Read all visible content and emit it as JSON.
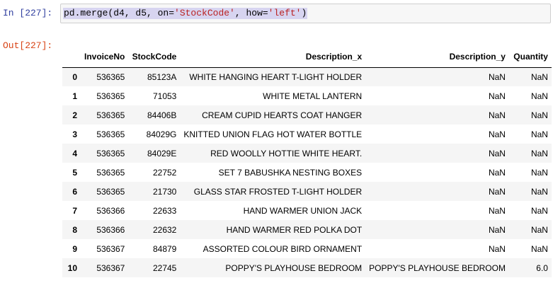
{
  "cell": {
    "in_prompt": "In [227]:",
    "out_prompt": "Out[227]:",
    "code_prefix": "pd.merge(d4, d5, on=",
    "code_arg1": "'StockCode'",
    "code_mid": ", how=",
    "code_arg2": "'left'",
    "code_suffix": ")"
  },
  "table": {
    "columns": [
      "",
      "InvoiceNo",
      "StockCode",
      "Description_x",
      "Description_y",
      "Quantity"
    ],
    "rows": [
      {
        "index": "0",
        "invoice": "536365",
        "stock": "85123A",
        "desc_x": "WHITE HANGING HEART T-LIGHT HOLDER",
        "desc_y": "NaN",
        "qty": "NaN"
      },
      {
        "index": "1",
        "invoice": "536365",
        "stock": "71053",
        "desc_x": "WHITE METAL LANTERN",
        "desc_y": "NaN",
        "qty": "NaN"
      },
      {
        "index": "2",
        "invoice": "536365",
        "stock": "84406B",
        "desc_x": "CREAM CUPID HEARTS COAT HANGER",
        "desc_y": "NaN",
        "qty": "NaN"
      },
      {
        "index": "3",
        "invoice": "536365",
        "stock": "84029G",
        "desc_x": "KNITTED UNION FLAG HOT WATER BOTTLE",
        "desc_y": "NaN",
        "qty": "NaN"
      },
      {
        "index": "4",
        "invoice": "536365",
        "stock": "84029E",
        "desc_x": "RED WOOLLY HOTTIE WHITE HEART.",
        "desc_y": "NaN",
        "qty": "NaN"
      },
      {
        "index": "5",
        "invoice": "536365",
        "stock": "22752",
        "desc_x": "SET 7 BABUSHKA NESTING BOXES",
        "desc_y": "NaN",
        "qty": "NaN"
      },
      {
        "index": "6",
        "invoice": "536365",
        "stock": "21730",
        "desc_x": "GLASS STAR FROSTED T-LIGHT HOLDER",
        "desc_y": "NaN",
        "qty": "NaN"
      },
      {
        "index": "7",
        "invoice": "536366",
        "stock": "22633",
        "desc_x": "HAND WARMER UNION JACK",
        "desc_y": "NaN",
        "qty": "NaN"
      },
      {
        "index": "8",
        "invoice": "536366",
        "stock": "22632",
        "desc_x": "HAND WARMER RED POLKA DOT",
        "desc_y": "NaN",
        "qty": "NaN"
      },
      {
        "index": "9",
        "invoice": "536367",
        "stock": "84879",
        "desc_x": "ASSORTED COLOUR BIRD ORNAMENT",
        "desc_y": "NaN",
        "qty": "NaN"
      },
      {
        "index": "10",
        "invoice": "536367",
        "stock": "22745",
        "desc_x": "POPPY'S PLAYHOUSE BEDROOM",
        "desc_y": "POPPY'S PLAYHOUSE BEDROOM",
        "qty": "6.0"
      }
    ]
  }
}
